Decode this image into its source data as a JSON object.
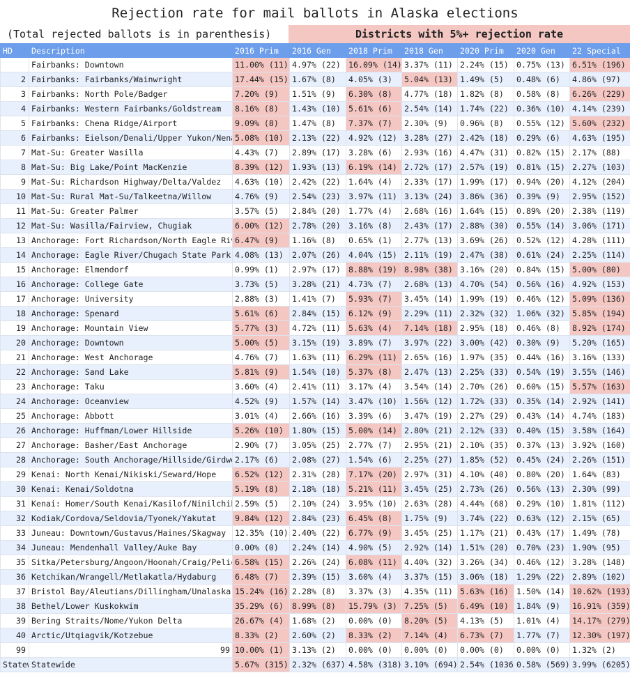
{
  "title": "Rejection rate for mail ballots in Alaska elections",
  "subtitle_left": "(Total rejected ballots is in parenthesis)",
  "subtitle_right": "Districts with 5%+ rejection rate",
  "highlight_color": "#f4c7c3",
  "header_color": "#6d9eeb",
  "stripe_color": "#e8f0fe",
  "columns": [
    "HD",
    "Description",
    "2016 Prim",
    "2016 Gen",
    "2018 Prim",
    "2018 Gen",
    "2020 Prim",
    "2020 Gen",
    "22 Special"
  ],
  "rows": [
    {
      "hd": "",
      "desc": "Fairbanks: Downtown",
      "vals": [
        "11.00% (11)",
        "4.97% (22)",
        "16.09% (14)",
        "3.37% (11)",
        "2.24% (15)",
        "0.75% (13)",
        "6.51% (196)"
      ],
      "hi": [
        0,
        2,
        6
      ]
    },
    {
      "hd": "2",
      "desc": "Fairbanks: Fairbanks/Wainwright",
      "vals": [
        "17.44% (15)",
        "1.67% (8)",
        "4.05% (3)",
        "5.04% (13)",
        "1.49% (5)",
        "0.48% (6)",
        "4.86% (97)"
      ],
      "hi": [
        0,
        3
      ]
    },
    {
      "hd": "3",
      "desc": "Fairbanks: North Pole/Badger",
      "vals": [
        "7.20% (9)",
        "1.51% (9)",
        "6.30% (8)",
        "4.77% (18)",
        "1.82% (8)",
        "0.58% (8)",
        "6.26% (229)"
      ],
      "hi": [
        0,
        2,
        6
      ]
    },
    {
      "hd": "4",
      "desc": "Fairbanks: Western Fairbanks/Goldstream",
      "vals": [
        "8.16% (8)",
        "1.43% (10)",
        "5.61% (6)",
        "2.54% (14)",
        "1.74% (22)",
        "0.36% (10)",
        "4.14% (239)"
      ],
      "hi": [
        0,
        2
      ]
    },
    {
      "hd": "5",
      "desc": "Fairbanks: Chena Ridge/Airport",
      "vals": [
        "9.09% (8)",
        "1.47% (8)",
        "7.37% (7)",
        "2.30% (9)",
        "0.96% (8)",
        "0.55% (12)",
        "5.60% (232)"
      ],
      "hi": [
        0,
        2,
        6
      ]
    },
    {
      "hd": "6",
      "desc": "Fairbanks: Eielson/Denali/Upper Yukon/Nenan",
      "vals": [
        "5.08% (10)",
        "2.13% (22)",
        "4.92% (12)",
        "3.28% (27)",
        "2.42% (18)",
        "0.29% (6)",
        "4.63% (195)"
      ],
      "hi": [
        0
      ]
    },
    {
      "hd": "7",
      "desc": "Mat-Su: Greater Wasilla",
      "vals": [
        "4.43% (7)",
        "2.89% (17)",
        "3.28% (6)",
        "2.93% (16)",
        "4.47% (31)",
        "0.82% (15)",
        "2.17% (88)"
      ],
      "hi": []
    },
    {
      "hd": "8",
      "desc": "Mat-Su: Big Lake/Point MacKenzie",
      "vals": [
        "8.39% (12)",
        "1.93% (13)",
        "6.19% (14)",
        "2.72% (17)",
        "2.57% (19)",
        "0.81% (15)",
        "2.27% (103)"
      ],
      "hi": [
        0,
        2
      ]
    },
    {
      "hd": "9",
      "desc": "Mat-Su: Richardson Highway/Delta/Valdez",
      "vals": [
        "4.63% (10)",
        "2.42% (22)",
        "1.64% (4)",
        "2.33% (17)",
        "1.99% (17)",
        "0.94% (20)",
        "4.12% (204)"
      ],
      "hi": []
    },
    {
      "hd": "10",
      "desc": "Mat-Su: Rural Mat-Su/Talkeetna/Willow",
      "vals": [
        "4.76% (9)",
        "2.54% (23)",
        "3.97% (11)",
        "3.13% (24)",
        "3.86% (36)",
        "0.39% (9)",
        "2.95% (152)"
      ],
      "hi": []
    },
    {
      "hd": "11",
      "desc": "Mat-Su: Greater Palmer",
      "vals": [
        "3.57% (5)",
        "2.84% (20)",
        "1.77% (4)",
        "2.68% (16)",
        "1.64% (15)",
        "0.89% (20)",
        "2.38% (119)"
      ],
      "hi": []
    },
    {
      "hd": "12",
      "desc": "Mat-Su: Wasilla/Fairview, Chugiak",
      "vals": [
        "6.00% (12)",
        "2.78% (20)",
        "3.16% (8)",
        "2.43% (17)",
        "2.88% (30)",
        "0.55% (14)",
        "3.06% (171)"
      ],
      "hi": [
        0
      ]
    },
    {
      "hd": "13",
      "desc": "Anchorage: Fort Richardson/North Eagle Rive",
      "vals": [
        "6.47% (9)",
        "1.16% (8)",
        "0.65% (1)",
        "2.77% (13)",
        "3.69% (26)",
        "0.52% (12)",
        "4.28% (111)"
      ],
      "hi": [
        0
      ]
    },
    {
      "hd": "14",
      "desc": "Anchorage: Eagle River/Chugach State Park",
      "vals": [
        "4.08% (13)",
        "2.07% (26)",
        "4.04% (15)",
        "2.11% (19)",
        "2.47% (38)",
        "0.61% (24)",
        "2.25% (114)"
      ],
      "hi": []
    },
    {
      "hd": "15",
      "desc": "Anchorage: Elmendorf",
      "vals": [
        "0.99% (1)",
        "2.97% (17)",
        "8.88% (19)",
        "8.98% (38)",
        "3.16% (20)",
        "0.84% (15)",
        "5.00% (80)"
      ],
      "hi": [
        2,
        3,
        6
      ]
    },
    {
      "hd": "16",
      "desc": "Anchorage: College Gate",
      "vals": [
        "3.73% (5)",
        "3.28% (21)",
        "4.73% (7)",
        "2.68% (13)",
        "4.70% (54)",
        "0.56% (16)",
        "4.92% (153)"
      ],
      "hi": []
    },
    {
      "hd": "17",
      "desc": "Anchorage: University",
      "vals": [
        "2.88% (3)",
        "1.41% (7)",
        "5.93% (7)",
        "3.45% (14)",
        "1.99% (19)",
        "0.46% (12)",
        "5.09% (136)"
      ],
      "hi": [
        2,
        6
      ]
    },
    {
      "hd": "18",
      "desc": "Anchorage: Spenard",
      "vals": [
        "5.61% (6)",
        "2.84% (15)",
        "6.12% (9)",
        "2.29% (11)",
        "2.32% (32)",
        "1.06% (32)",
        "5.85% (194)"
      ],
      "hi": [
        0,
        2,
        6
      ]
    },
    {
      "hd": "19",
      "desc": "Anchorage: Mountain View",
      "vals": [
        "5.77% (3)",
        "4.72% (11)",
        "5.63% (4)",
        "7.14% (18)",
        "2.95% (18)",
        "0.46% (8)",
        "8.92% (174)"
      ],
      "hi": [
        0,
        2,
        3,
        6
      ]
    },
    {
      "hd": "20",
      "desc": "Anchorage: Downtown",
      "vals": [
        "5.00% (5)",
        "3.15% (19)",
        "3.89% (7)",
        "3.97% (22)",
        "3.00% (42)",
        "0.30% (9)",
        "5.20% (165)"
      ],
      "hi": [
        0
      ]
    },
    {
      "hd": "21",
      "desc": "Anchorage: West Anchorage",
      "vals": [
        "4.76% (7)",
        "1.63% (11)",
        "6.29% (11)",
        "2.65% (16)",
        "1.97% (35)",
        "0.44% (16)",
        "3.16% (133)"
      ],
      "hi": [
        2
      ]
    },
    {
      "hd": "22",
      "desc": "Anchorage: Sand Lake",
      "vals": [
        "5.81% (9)",
        "1.54% (10)",
        "5.37% (8)",
        "2.47% (13)",
        "2.25% (33)",
        "0.54% (19)",
        "3.55% (146)"
      ],
      "hi": [
        0,
        2
      ]
    },
    {
      "hd": "23",
      "desc": "Anchorage: Taku",
      "vals": [
        "3.60% (4)",
        "2.41% (11)",
        "3.17% (4)",
        "3.54% (14)",
        "2.70% (26)",
        "0.60% (15)",
        "5.57% (163)"
      ],
      "hi": [
        6
      ]
    },
    {
      "hd": "24",
      "desc": "Anchorage: Oceanview",
      "vals": [
        "4.52% (9)",
        "1.57% (14)",
        "3.47% (10)",
        "1.56% (12)",
        "1.72% (33)",
        "0.35% (14)",
        "2.92% (141)"
      ],
      "hi": []
    },
    {
      "hd": "25",
      "desc": "Anchorage: Abbott",
      "vals": [
        "3.01% (4)",
        "2.66% (16)",
        "3.39% (6)",
        "3.47% (19)",
        "2.27% (29)",
        "0.43% (14)",
        "4.74% (183)"
      ],
      "hi": []
    },
    {
      "hd": "26",
      "desc": "Anchorage: Huffman/Lower Hillside",
      "vals": [
        "5.26% (10)",
        "1.80% (15)",
        "5.00% (14)",
        "2.80% (21)",
        "2.12% (33)",
        "0.40% (15)",
        "3.58% (164)"
      ],
      "hi": [
        0,
        2
      ]
    },
    {
      "hd": "27",
      "desc": "Anchorage: Basher/East Anchorage",
      "vals": [
        "2.90% (7)",
        "3.05% (25)",
        "2.77% (7)",
        "2.95% (21)",
        "2.10% (35)",
        "0.37% (13)",
        "3.92% (160)"
      ],
      "hi": []
    },
    {
      "hd": "28",
      "desc": "Anchorage: South Anchorage/Hillside/Girdwoo",
      "vals": [
        "2.17% (6)",
        "2.08% (27)",
        "1.54% (6)",
        "2.25% (27)",
        "1.85% (52)",
        "0.45% (24)",
        "2.26% (151)"
      ],
      "hi": []
    },
    {
      "hd": "29",
      "desc": "Kenai: North Kenai/Nikiski/Seward/Hope",
      "vals": [
        "6.52% (12)",
        "2.31% (28)",
        "7.17% (20)",
        "2.97% (31)",
        "4.10% (40)",
        "0.80% (20)",
        "1.64% (83)"
      ],
      "hi": [
        0,
        2
      ]
    },
    {
      "hd": "30",
      "desc": "Kenai: Kenai/Soldotna",
      "vals": [
        "5.19% (8)",
        "2.18% (18)",
        "5.21% (11)",
        "3.45% (25)",
        "2.73% (26)",
        "0.56% (13)",
        "2.30% (99)"
      ],
      "hi": [
        0,
        2
      ]
    },
    {
      "hd": "31",
      "desc": "Kenai: Homer/South Kenai/Kasilof/Ninilchik",
      "vals": [
        "2.59% (5)",
        "2.10% (24)",
        "3.95% (10)",
        "2.63% (28)",
        "4.44% (68)",
        "0.29% (10)",
        "1.81% (112)"
      ],
      "hi": []
    },
    {
      "hd": "32",
      "desc": "Kodiak/Cordova/Seldovia/Tyonek/Yakutat",
      "vals": [
        "9.84% (12)",
        "2.84% (23)",
        "6.45% (8)",
        "1.75% (9)",
        "3.74% (22)",
        "0.63% (12)",
        "2.15% (65)"
      ],
      "hi": [
        0,
        2
      ]
    },
    {
      "hd": "33",
      "desc": "Juneau: Downtown/Gustavus/Haines/Skagway",
      "vals": [
        "12.35% (10)",
        "2.40% (22)",
        "6.77% (9)",
        "3.45% (25)",
        "1.17% (21)",
        "0.43% (17)",
        "1.49% (78)"
      ],
      "hi": [
        2
      ]
    },
    {
      "hd": "34",
      "desc": "Juneau: Mendenhall Valley/Auke Bay",
      "vals": [
        "0.00% (0)",
        "2.24% (14)",
        "4.90% (5)",
        "2.92% (14)",
        "1.51% (20)",
        "0.70% (23)",
        "1.90% (95)"
      ],
      "hi": []
    },
    {
      "hd": "35",
      "desc": "Sitka/Petersburg/Angoon/Hoonah/Craig/Pelica",
      "vals": [
        "6.58% (15)",
        "2.26% (24)",
        "6.08% (11)",
        "4.40% (32)",
        "3.26% (34)",
        "0.46% (12)",
        "3.28% (148)"
      ],
      "hi": [
        0,
        2
      ]
    },
    {
      "hd": "36",
      "desc": "Ketchikan/Wrangell/Metlakatla/Hydaburg",
      "vals": [
        "6.48% (7)",
        "2.39% (15)",
        "3.60% (4)",
        "3.37% (15)",
        "3.06% (18)",
        "1.29% (22)",
        "2.89% (102)"
      ],
      "hi": [
        0
      ]
    },
    {
      "hd": "37",
      "desc": "Bristol Bay/Aleutians/Dillingham/Unalaska",
      "vals": [
        "15.24% (16)",
        "2.28% (8)",
        "3.37% (3)",
        "4.35% (11)",
        "5.63% (16)",
        "1.50% (14)",
        "10.62% (193)"
      ],
      "hi": [
        0,
        4,
        6
      ]
    },
    {
      "hd": "38",
      "desc": "Bethel/Lower Kuskokwim",
      "vals": [
        "35.29% (6)",
        "8.99% (8)",
        "15.79% (3)",
        "7.25% (5)",
        "6.49% (10)",
        "1.84% (9)",
        "16.91% (359)"
      ],
      "hi": [
        0,
        1,
        2,
        3,
        4,
        6
      ]
    },
    {
      "hd": "39",
      "desc": "Bering Straits/Nome/Yukon Delta",
      "vals": [
        "26.67% (4)",
        "1.68% (2)",
        "0.00% (0)",
        "8.20% (5)",
        "4.13% (5)",
        "1.01% (4)",
        "14.17% (279)"
      ],
      "hi": [
        0,
        3,
        6
      ]
    },
    {
      "hd": "40",
      "desc": "Arctic/Utqiagvik/Kotzebue",
      "vals": [
        "8.33% (2)",
        "2.60% (2)",
        "8.33% (2)",
        "7.14% (4)",
        "6.73% (7)",
        "1.77% (7)",
        "12.30% (197)"
      ],
      "hi": [
        0,
        2,
        3,
        4,
        6
      ]
    },
    {
      "hd": "99",
      "desc": "99",
      "vals": [
        "10.00% (1)",
        "3.13% (2)",
        "0.00% (0)",
        "0.00% (0)",
        "0.00% (0)",
        "0.00% (0)",
        "1.32% (2)"
      ],
      "hi": [
        0
      ],
      "desc_right": true
    },
    {
      "hd": "Statew",
      "desc": "Statewide",
      "vals": [
        "5.67% (315)",
        "2.32% (637)",
        "4.58% (318)",
        "3.10% (694)",
        "2.54% (1036)",
        "0.58% (569)",
        "3.99% (6205)"
      ],
      "hi": [
        0
      ]
    }
  ]
}
